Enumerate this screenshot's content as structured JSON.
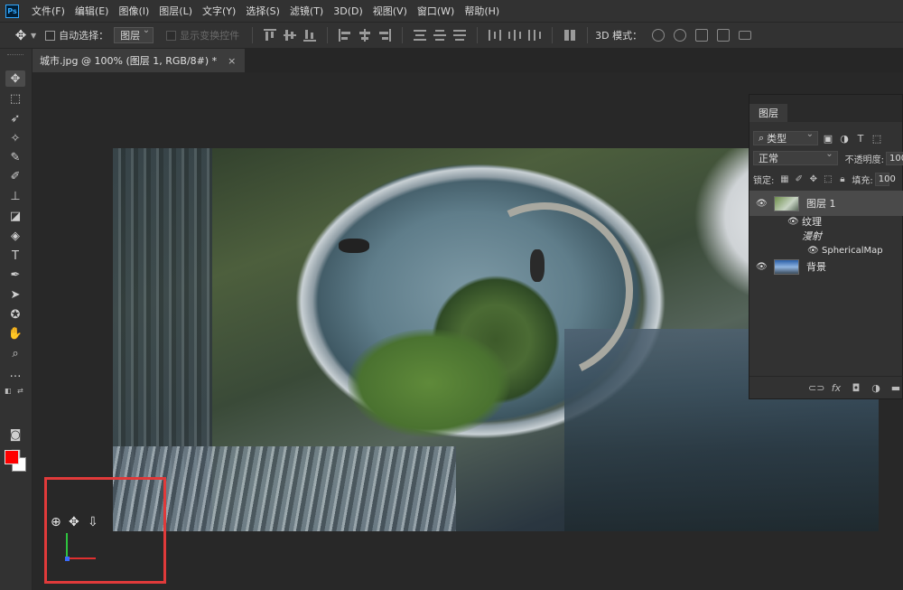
{
  "menu": {
    "logo": "Ps",
    "items": [
      "文件(F)",
      "编辑(E)",
      "图像(I)",
      "图层(L)",
      "文字(Y)",
      "选择(S)",
      "滤镜(T)",
      "3D(D)",
      "视图(V)",
      "窗口(W)",
      "帮助(H)"
    ]
  },
  "options": {
    "auto_select_label": "自动选择：",
    "auto_select_value": "图层",
    "show_transform_label": "显示变换控件",
    "mode_3d_label": "3D 模式："
  },
  "document": {
    "tab_title": "城市.jpg @ 100% (图层 1, RGB/8#) *",
    "close": "×"
  },
  "colors": {
    "foreground": "#ff0000",
    "background": "#ffffff",
    "highlight_box": "#e03a3a"
  },
  "layers_panel": {
    "tab": "图层",
    "filter_kind": "类型",
    "blend_mode": "正常",
    "opacity_label": "不透明度:",
    "opacity_value": "100",
    "lock_label": "锁定:",
    "fill_label": "填充:",
    "fill_value": "100",
    "layers": [
      {
        "name": "图层 1",
        "selected": true
      },
      {
        "name": "纹理",
        "sub": true
      },
      {
        "name": "漫射",
        "sub": true,
        "italic": true
      },
      {
        "name": "SphericalMap",
        "sub": true
      },
      {
        "name": "背景"
      }
    ]
  },
  "icons": {
    "tools": [
      "move-icon",
      "marquee-icon",
      "lasso-icon",
      "magic-wand-icon",
      "eyedropper-icon",
      "brush-icon",
      "stamp-icon",
      "eraser-icon",
      "bucket-icon",
      "type-icon",
      "pen-icon",
      "path-select-icon",
      "shape-icon",
      "hand-icon",
      "zoom-icon",
      "more-tools-icon"
    ],
    "widget": [
      "orbit-icon",
      "pan-icon",
      "dolly-icon"
    ]
  }
}
